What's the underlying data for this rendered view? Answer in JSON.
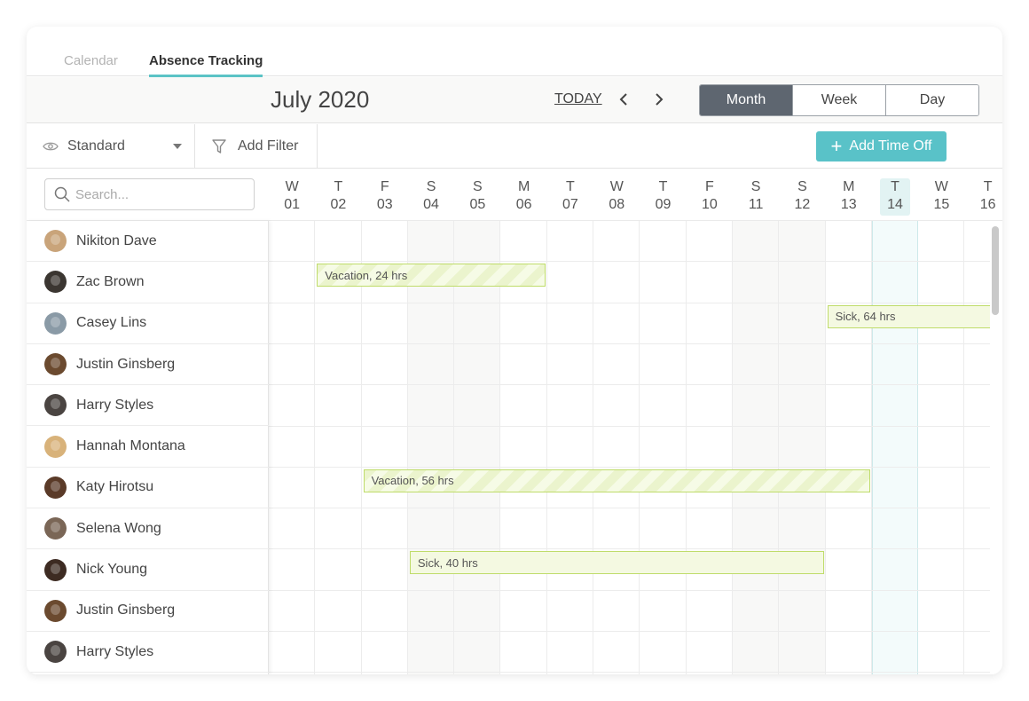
{
  "tabs": [
    {
      "label": "Calendar",
      "active": false
    },
    {
      "label": "Absence Tracking",
      "active": true
    }
  ],
  "header": {
    "title": "July 2020",
    "today_label": "TODAY",
    "views": [
      {
        "label": "Month",
        "active": true
      },
      {
        "label": "Week",
        "active": false
      },
      {
        "label": "Day",
        "active": false
      }
    ]
  },
  "toolbar": {
    "view_select": "Standard",
    "filter_label": "Add Filter",
    "add_button": "Add Time Off"
  },
  "search": {
    "placeholder": "Search..."
  },
  "days": [
    {
      "dow": "W",
      "date": "01"
    },
    {
      "dow": "T",
      "date": "02"
    },
    {
      "dow": "F",
      "date": "03"
    },
    {
      "dow": "S",
      "date": "04"
    },
    {
      "dow": "S",
      "date": "05"
    },
    {
      "dow": "M",
      "date": "06"
    },
    {
      "dow": "T",
      "date": "07"
    },
    {
      "dow": "W",
      "date": "08"
    },
    {
      "dow": "T",
      "date": "09"
    },
    {
      "dow": "F",
      "date": "10"
    },
    {
      "dow": "S",
      "date": "11"
    },
    {
      "dow": "S",
      "date": "12"
    },
    {
      "dow": "M",
      "date": "13"
    },
    {
      "dow": "T",
      "date": "14"
    },
    {
      "dow": "W",
      "date": "15"
    },
    {
      "dow": "T",
      "date": "16"
    }
  ],
  "today_date": "14",
  "people": [
    {
      "name": "Nikiton Dave",
      "avatar_color": "#c9a47a"
    },
    {
      "name": "Zac Brown",
      "avatar_color": "#3b3631"
    },
    {
      "name": "Casey Lins",
      "avatar_color": "#8a9aa6"
    },
    {
      "name": "Justin Ginsberg",
      "avatar_color": "#6b4a2f"
    },
    {
      "name": "Harry Styles",
      "avatar_color": "#4a4441"
    },
    {
      "name": "Hannah Montana",
      "avatar_color": "#d8b27a"
    },
    {
      "name": "Katy Hirotsu",
      "avatar_color": "#5a3a28"
    },
    {
      "name": "Selena Wong",
      "avatar_color": "#7a6656"
    },
    {
      "name": "Nick Young",
      "avatar_color": "#3d2b22"
    },
    {
      "name": "Justin Ginsberg",
      "avatar_color": "#6b4a2f"
    },
    {
      "name": "Harry Styles",
      "avatar_color": "#4a4441"
    }
  ],
  "absences": [
    {
      "person_index": 1,
      "label": "Vacation, 24 hrs",
      "type": "vacation",
      "start_day": "02",
      "end_day": "06"
    },
    {
      "person_index": 2,
      "label": "Sick, 64 hrs",
      "type": "sick",
      "start_day": "13",
      "end_day": "16"
    },
    {
      "person_index": 6,
      "label": "Vacation, 56 hrs",
      "type": "vacation",
      "start_day": "03",
      "end_day": "13"
    },
    {
      "person_index": 8,
      "label": "Sick, 40 hrs",
      "type": "sick",
      "start_day": "04",
      "end_day": "12"
    }
  ],
  "colors": {
    "accent": "#59c2c8",
    "active_view": "#5e6670",
    "bar_border": "#bfdc6a"
  }
}
